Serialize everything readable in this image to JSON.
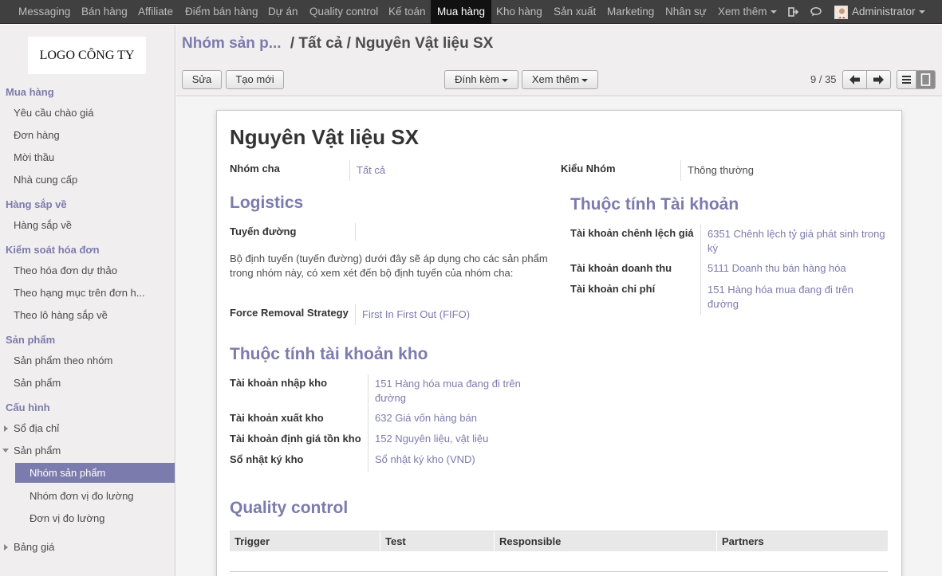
{
  "topbar": {
    "menus": [
      "Messaging",
      "Bán hàng",
      "Affiliate",
      "Điểm bán hàng",
      "Dự án",
      "Quality control",
      "Kế toán",
      "Mua hàng",
      "Kho hàng",
      "Sản xuất",
      "Marketing",
      "Nhân sự",
      "Xem thêm"
    ],
    "active_menu": "Mua hàng",
    "user": "Administrator",
    "icons": [
      "logout-icon",
      "chat-icon"
    ]
  },
  "sidebar": {
    "logo": "LOGO CÔNG TY",
    "sections": [
      {
        "title": "Mua hàng",
        "items": [
          "Yêu cầu chào giá",
          "Đơn hàng",
          "Mời thầu",
          "Nhà cung cấp"
        ]
      },
      {
        "title": "Hàng sắp về",
        "items": [
          "Hàng sắp về"
        ]
      },
      {
        "title": "Kiểm soát hóa đơn",
        "items": [
          "Theo hóa đơn dự thảo",
          "Theo hạng mục trên đơn h...",
          "Theo lô hàng sắp về"
        ]
      },
      {
        "title": "Sản phẩm",
        "items": [
          "Sản phẩm theo nhóm",
          "Sản phẩm"
        ]
      },
      {
        "title": "Cấu hình",
        "items": [
          "Sổ địa chỉ",
          "Sản phẩm",
          "Nhóm sản phẩm",
          "Nhóm đơn vị đo lường",
          "Đơn vị đo lường",
          "Bảng giá"
        ]
      }
    ]
  },
  "control_panel": {
    "breadcrumb_link": "Nhóm sản p...",
    "breadcrumb_sep": "/",
    "breadcrumb_current": "Tất cả / Nguyên Vật liệu SX",
    "edit": "Sửa",
    "create": "Tạo mới",
    "attach": "Đính kèm",
    "more": "Xem thêm",
    "pager": "9 / 35"
  },
  "form": {
    "name": "Nguyên Vật liệu SX",
    "parent_label": "Nhóm cha",
    "parent_value": "Tất cả",
    "type_label": "Kiểu Nhóm",
    "type_value": "Thông thường",
    "logistics_title": "Logistics",
    "routes_label": "Tuyến đường",
    "routes_help": "Bộ định tuyến (tuyến đường) dưới đây sẽ áp dụng cho các sản phẩm trong nhóm này, có xem xét đến bộ định tuyến của nhóm cha:",
    "removal_label": "Force Removal Strategy",
    "removal_value": "First In First Out (FIFO)",
    "account_title": "Thuộc tính Tài khoản",
    "acc_diff_label": "Tài khoản chênh lệch giá",
    "acc_diff_value": "6351 Chênh lệch tỷ giá phát sinh trong kỳ",
    "acc_income_label": "Tài khoản doanh thu",
    "acc_income_value": "5111 Doanh thu bán hàng hóa",
    "acc_expense_label": "Tài khoản chi phí",
    "acc_expense_value": "151 Hàng hóa mua đang đi trên đường",
    "stock_title": "Thuộc tính tài khoản kho",
    "stock_in_label": "Tài khoản nhập kho",
    "stock_in_value": "151 Hàng hóa mua đang đi trên đường",
    "stock_out_label": "Tài khoản xuất kho",
    "stock_out_value": "632 Giá vốn hàng bán",
    "stock_val_label": "Tài khoản định giá tồn kho",
    "stock_val_value": "152 Nguyên liệu, vật liệu",
    "journal_label": "Sổ nhật ký kho",
    "journal_value": "Sổ nhật ký kho (VND)",
    "qc_title": "Quality control",
    "qc_columns": [
      "Trigger",
      "Test",
      "Responsible",
      "Partners"
    ]
  },
  "colors": {
    "accent": "#7c7bad",
    "topbar": "#404040",
    "sidebar": "#f0eeee"
  }
}
